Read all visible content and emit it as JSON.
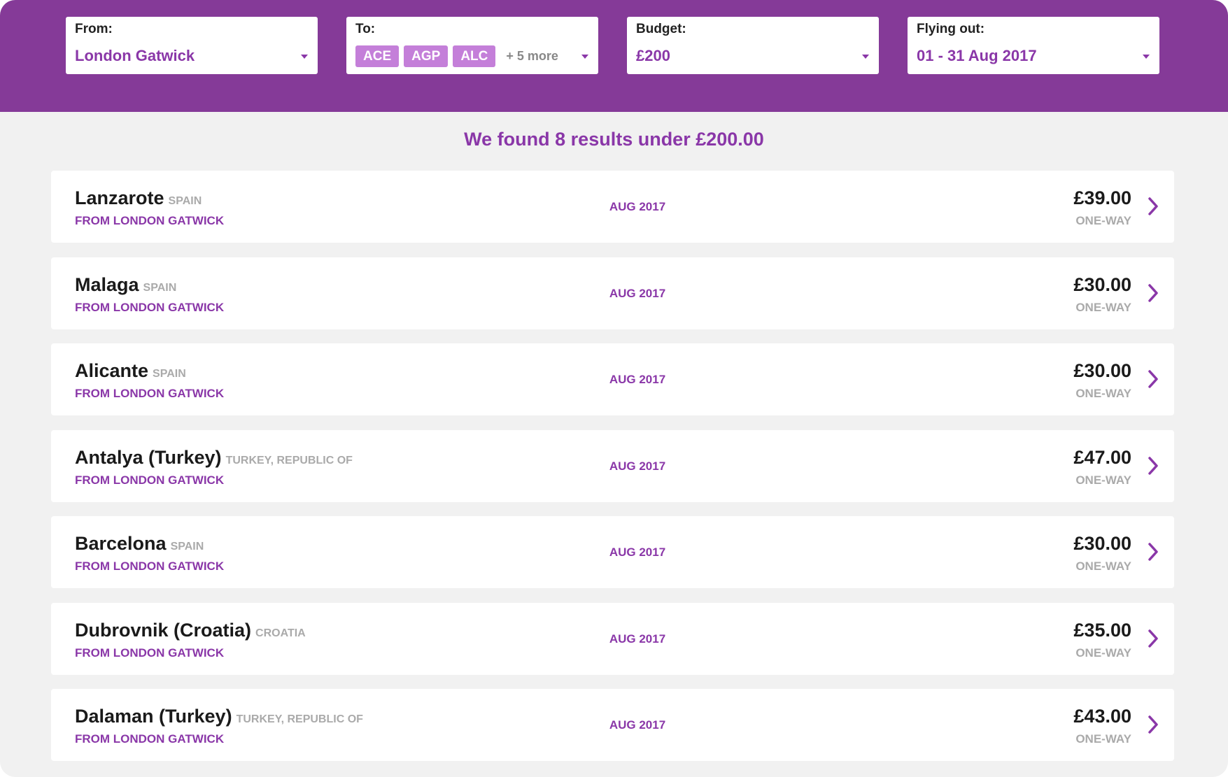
{
  "search": {
    "from": {
      "label": "From:",
      "value": "London Gatwick",
      "caret_icon": "chevron-down-icon"
    },
    "to": {
      "label": "To:",
      "chips": [
        "ACE",
        "AGP",
        "ALC"
      ],
      "more": "+ 5 more",
      "caret_icon": "chevron-down-icon"
    },
    "budget": {
      "label": "Budget:",
      "value": "£200",
      "caret_icon": "chevron-down-icon"
    },
    "flying_out": {
      "label": "Flying out:",
      "value": "01 - 31 Aug 2017",
      "caret_icon": "chevron-down-icon"
    }
  },
  "results_title": "We found 8 results under £200.00",
  "results": [
    {
      "city": "Lanzarote",
      "country": "SPAIN",
      "from": "FROM LONDON GATWICK",
      "date": "AUG 2017",
      "price": "£39.00",
      "trip": "ONE-WAY",
      "icon": "chevron-right-icon"
    },
    {
      "city": "Malaga",
      "country": "SPAIN",
      "from": "FROM LONDON GATWICK",
      "date": "AUG 2017",
      "price": "£30.00",
      "trip": "ONE-WAY",
      "icon": "chevron-right-icon"
    },
    {
      "city": "Alicante",
      "country": "SPAIN",
      "from": "FROM LONDON GATWICK",
      "date": "AUG 2017",
      "price": "£30.00",
      "trip": "ONE-WAY",
      "icon": "chevron-right-icon"
    },
    {
      "city": "Antalya (Turkey)",
      "country": "TURKEY, REPUBLIC OF",
      "from": "FROM LONDON GATWICK",
      "date": "AUG 2017",
      "price": "£47.00",
      "trip": "ONE-WAY",
      "icon": "chevron-right-icon"
    },
    {
      "city": "Barcelona",
      "country": "SPAIN",
      "from": "FROM LONDON GATWICK",
      "date": "AUG 2017",
      "price": "£30.00",
      "trip": "ONE-WAY",
      "icon": "chevron-right-icon"
    },
    {
      "city": "Dubrovnik (Croatia)",
      "country": "CROATIA",
      "from": "FROM LONDON GATWICK",
      "date": "AUG 2017",
      "price": "£35.00",
      "trip": "ONE-WAY",
      "icon": "chevron-right-icon"
    },
    {
      "city": "Dalaman (Turkey)",
      "country": "TURKEY, REPUBLIC OF",
      "from": "FROM LONDON GATWICK",
      "date": "AUG 2017",
      "price": "£43.00",
      "trip": "ONE-WAY",
      "icon": "chevron-right-icon"
    }
  ],
  "colors": {
    "brand": "#853a98",
    "accent": "#8a37a8",
    "chip": "#c47fd9",
    "page_bg": "#f1f1f1"
  }
}
